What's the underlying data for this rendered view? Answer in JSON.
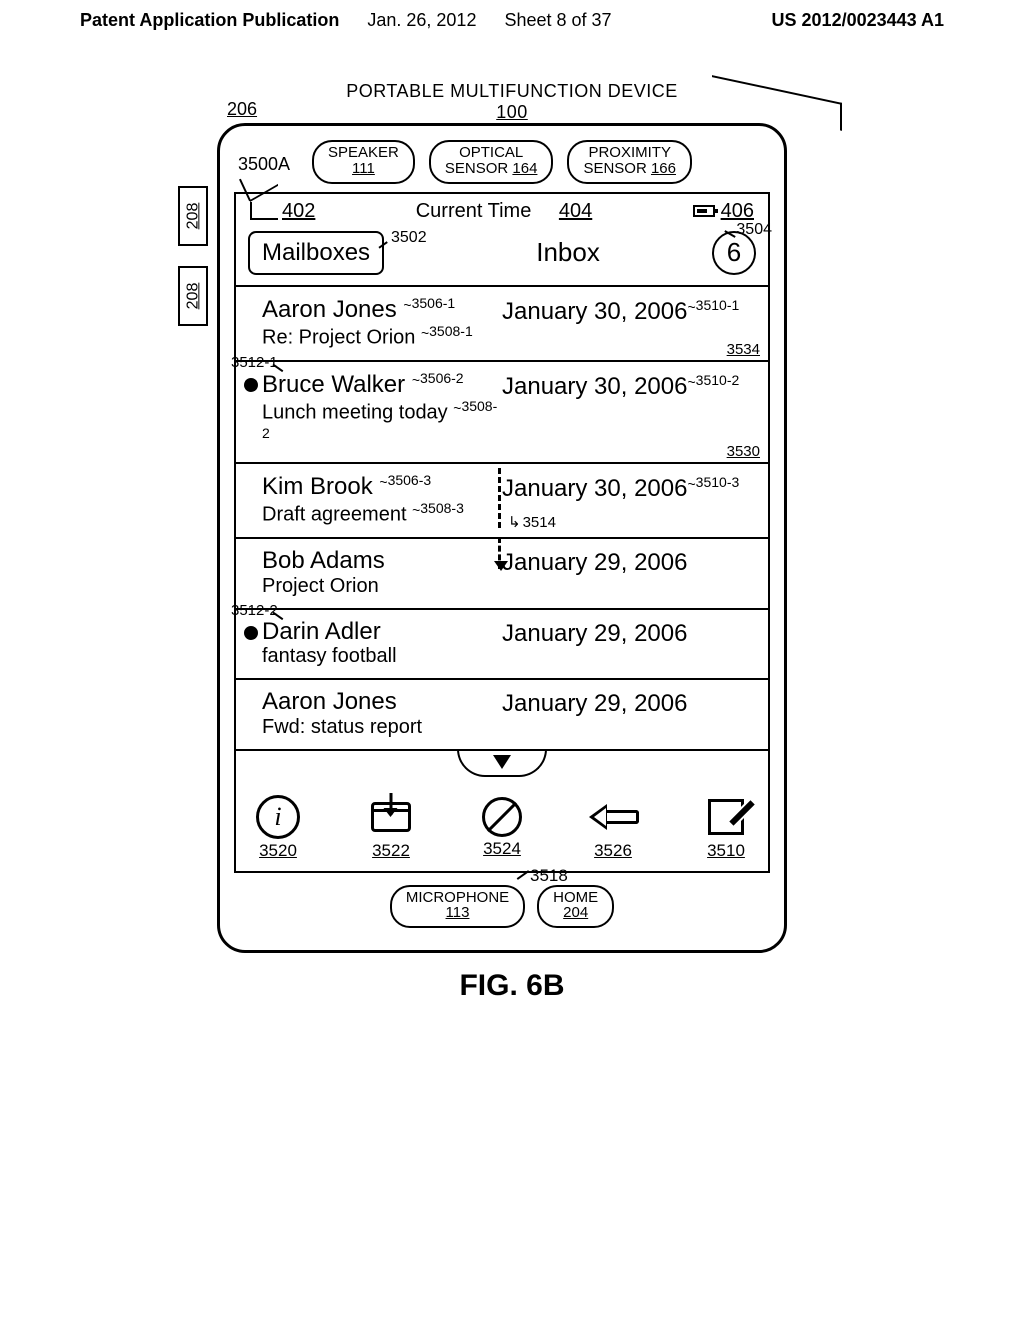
{
  "header": {
    "left": "Patent Application Publication",
    "date": "Jan. 26, 2012",
    "sheet": "Sheet 8 of 37",
    "pubno": "US 2012/0023443 A1"
  },
  "device": {
    "title_prefix": "PORTABLE MULTIFUNCTION DEVICE",
    "title_num": "100",
    "ref_206": "206",
    "ref_208": "208",
    "ref_3500A": "3500A",
    "speaker": {
      "label": "SPEAKER",
      "num": "111"
    },
    "optical": {
      "label": "OPTICAL",
      "label2": "SENSOR",
      "num": "164"
    },
    "proximity": {
      "label": "PROXIMITY",
      "label2": "SENSOR",
      "num": "166"
    },
    "microphone": {
      "label": "MICROPHONE",
      "num": "113"
    },
    "home": {
      "label": "HOME",
      "num": "204"
    }
  },
  "status": {
    "signal_ref": "402",
    "time_label": "Current Time",
    "time_ref": "404",
    "battery_ref": "406"
  },
  "nav": {
    "back": "Mailboxes",
    "back_ref": "3502",
    "title": "Inbox",
    "count": "6",
    "count_ref": "3504"
  },
  "rows": [
    {
      "sender": "Aaron Jones",
      "sender_ref": "3506-1",
      "subject": "Re: Project Orion",
      "subject_ref": "3508-1",
      "date": "January 30, 2006",
      "date_ref": "3510-1",
      "row_ref": "3534",
      "unread": false
    },
    {
      "sender": "Bruce Walker",
      "sender_ref": "3506-2",
      "subject": "Lunch meeting today",
      "subject_ref": "3508-2",
      "date": "January 30, 2006",
      "date_ref": "3510-2",
      "row_ref": "3530",
      "unread": true,
      "dot_ref": "3512-1"
    },
    {
      "sender": "Kim Brook",
      "sender_ref": "3506-3",
      "subject": "Draft agreement",
      "subject_ref": "3508-3",
      "date": "January 30, 2006",
      "date_ref": "3510-3",
      "arrow_ref": "3514",
      "unread": false
    },
    {
      "sender": "Bob Adams",
      "subject": "Project Orion",
      "date": "January 29, 2006",
      "unread": false
    },
    {
      "sender": "Darin Adler",
      "subject": "fantasy football",
      "date": "January 29, 2006",
      "unread": true,
      "dot_ref": "3512-2"
    },
    {
      "sender": "Aaron Jones",
      "subject": "Fwd: status report",
      "date": "January 29, 2006",
      "unread": false
    }
  ],
  "more_ref": "3518",
  "toolbar": {
    "info": "3520",
    "inbox": "3522",
    "block": "3524",
    "reply": "3526",
    "compose": "3510"
  },
  "caption": "FIG. 6B"
}
